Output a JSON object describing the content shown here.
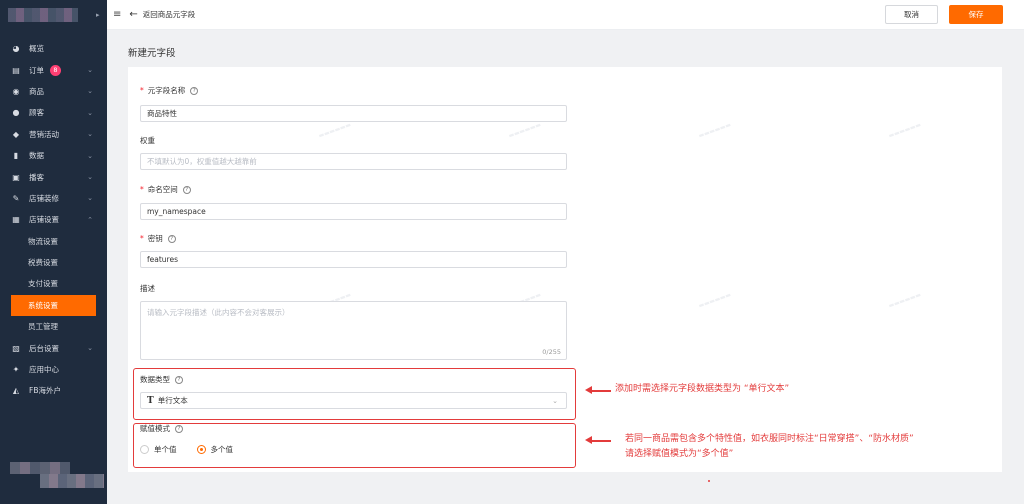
{
  "sidebar": {
    "items": [
      {
        "label": "概览",
        "icon": "dashboard-icon"
      },
      {
        "label": "订单",
        "icon": "order-icon",
        "badge": "8"
      },
      {
        "label": "商品",
        "icon": "product-icon"
      },
      {
        "label": "顾客",
        "icon": "customer-icon"
      },
      {
        "label": "营销活动",
        "icon": "tag-icon"
      },
      {
        "label": "数据",
        "icon": "chart-icon"
      },
      {
        "label": "播客",
        "icon": "podcast-icon"
      },
      {
        "label": "店铺装修",
        "icon": "brush-icon"
      },
      {
        "label": "店铺设置",
        "icon": "store-icon"
      }
    ],
    "sub_items": [
      "物流设置",
      "税费设置",
      "支付设置",
      "系统设置",
      "员工管理"
    ],
    "bottom_items": [
      {
        "label": "后台设置",
        "icon": "settings-icon"
      },
      {
        "label": "应用中心",
        "icon": "wrench-icon"
      },
      {
        "label": "FB海外户",
        "icon": "ad-icon"
      }
    ]
  },
  "topbar": {
    "back_label": "返回商品元字段",
    "cancel_label": "取消",
    "save_label": "保存"
  },
  "page": {
    "title": "新建元字段"
  },
  "form": {
    "name_label": "元字段名称",
    "name_value": "商品特性",
    "weight_label": "权重",
    "weight_placeholder": "不填默认为0，权重值越大越靠前",
    "namespace_label": "命名空间",
    "namespace_value": "my_namespace",
    "key_label": "密钥",
    "key_value": "features",
    "desc_label": "描述",
    "desc_placeholder": "请输入元字段描述（此内容不会对客展示）",
    "desc_counter": "0/255",
    "type_label": "数据类型",
    "type_value": "单行文本",
    "mode_label": "赋值模式",
    "mode_options": [
      "单个值",
      "多个值"
    ],
    "mode_selected": "多个值"
  },
  "annotations": {
    "note_type": "添加时需选择元字段数据类型为 “单行文本”",
    "note_mode_line1": "若同一商品需包含多个特性值，如衣服同时标注“日常穿搭”、“防水材质”",
    "note_mode_line2": "请选择赋值模式为“多个值”"
  },
  "colors": {
    "accent": "#ff6a00",
    "sidebar_bg": "#1f2c3e",
    "annotation": "#e33b3b"
  }
}
